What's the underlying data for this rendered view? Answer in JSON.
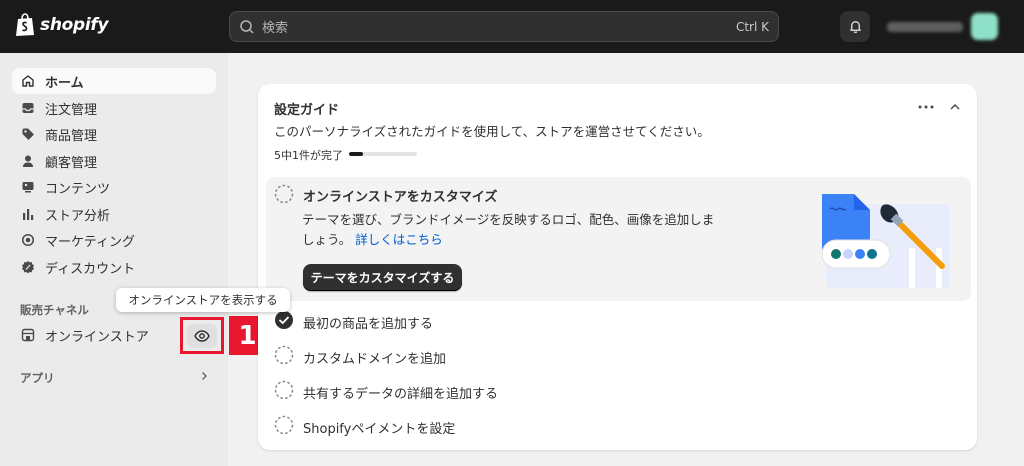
{
  "topbar": {
    "brand": "shopify",
    "search_placeholder": "検索",
    "search_shortcut": "Ctrl K"
  },
  "sidebar": {
    "items": [
      {
        "label": "ホーム",
        "icon": "home-icon"
      },
      {
        "label": "注文管理",
        "icon": "inbox-icon"
      },
      {
        "label": "商品管理",
        "icon": "tag-icon"
      },
      {
        "label": "顧客管理",
        "icon": "person-icon"
      },
      {
        "label": "コンテンツ",
        "icon": "content-icon"
      },
      {
        "label": "ストア分析",
        "icon": "bar-chart-icon"
      },
      {
        "label": "マーケティング",
        "icon": "target-icon"
      },
      {
        "label": "ディスカウント",
        "icon": "discount-icon"
      }
    ],
    "sales_channels_label": "販売チャネル",
    "online_store_label": "オンラインストア",
    "apps_label": "アプリ",
    "tooltip": "オンラインストアを表示する",
    "annotation_number": "1"
  },
  "setup_guide": {
    "title": "設定ガイド",
    "description": "このパーソナライズされたガイドを使用して、ストアを運営させてください。",
    "progress_label": "5中1件が完了",
    "progress_fraction": 0.2,
    "tasks": [
      {
        "title": "オンラインストアをカスタマイズ",
        "done": false,
        "expanded": true
      },
      {
        "title": "最初の商品を追加する",
        "done": true
      },
      {
        "title": "カスタムドメインを追加",
        "done": false
      },
      {
        "title": "共有するデータの詳細を追加する",
        "done": false
      },
      {
        "title": "Shopifyペイメントを設定",
        "done": false
      }
    ],
    "expanded_body_line1": "テーマを選び、ブランドイメージを反映するロゴ、配色、画像を追加しま",
    "expanded_body_line2": "しょう。",
    "expanded_link": "詳しくはこちら",
    "cta_label": "テーマをカスタマイズする"
  },
  "colors": {
    "topbar": "#1a1a1a",
    "accent_annotation": "#e8162e",
    "link": "#005bd3",
    "illustration_blue": "#3b82f6"
  }
}
